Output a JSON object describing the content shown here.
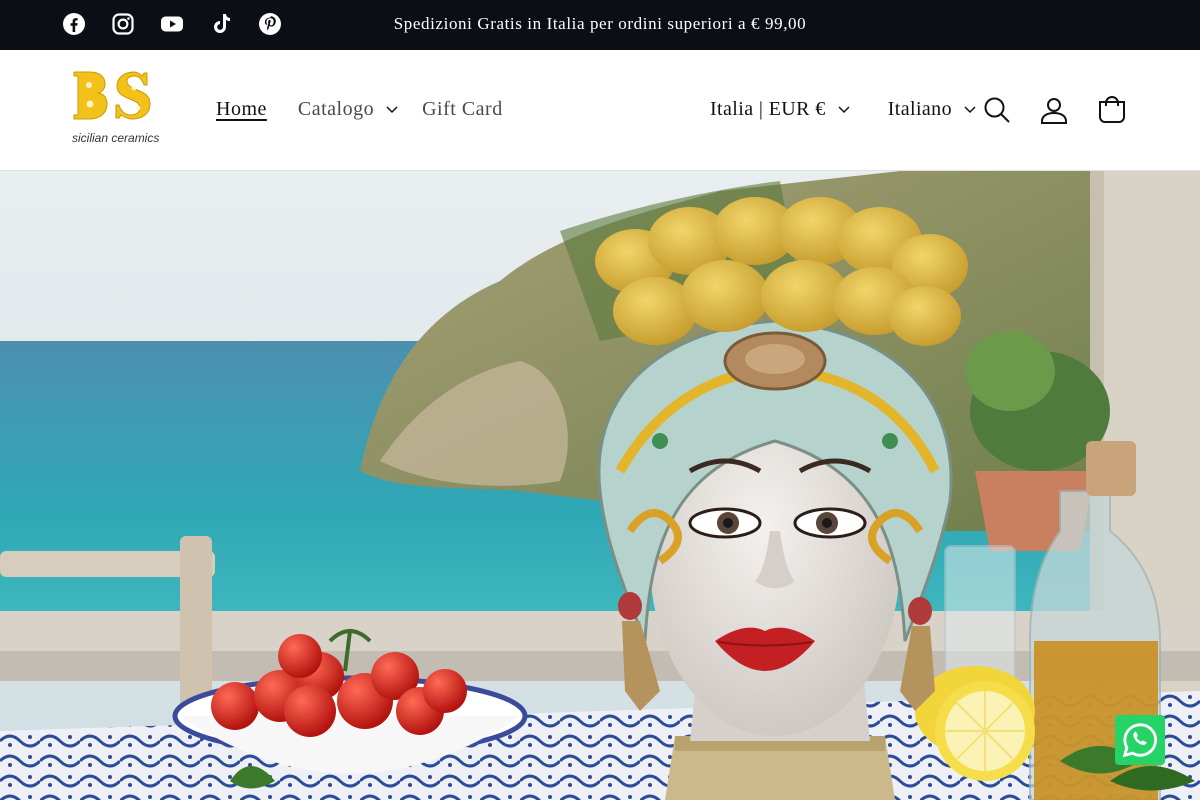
{
  "announcement": {
    "text": "Spedizioni Gratis in Italia per ordini superiori a € 99,00",
    "social": [
      {
        "name": "facebook-icon"
      },
      {
        "name": "instagram-icon"
      },
      {
        "name": "youtube-icon"
      },
      {
        "name": "tiktok-icon"
      },
      {
        "name": "pinterest-icon"
      }
    ]
  },
  "logo": {
    "mark": "BS",
    "subtitle": "sicilian ceramics"
  },
  "nav": {
    "home": "Home",
    "catalog": "Catalogo",
    "gift_card": "Gift Card"
  },
  "localization": {
    "country": "Italia | EUR €",
    "language": "Italiano"
  },
  "header_icons": [
    "search-icon",
    "account-icon",
    "cart-icon"
  ],
  "floating": {
    "icon": "whatsapp-icon"
  },
  "colors": {
    "announcement_bg": "#0b0e14",
    "logo_yellow": "#f2c21b",
    "whatsapp_green": "#25d366"
  }
}
